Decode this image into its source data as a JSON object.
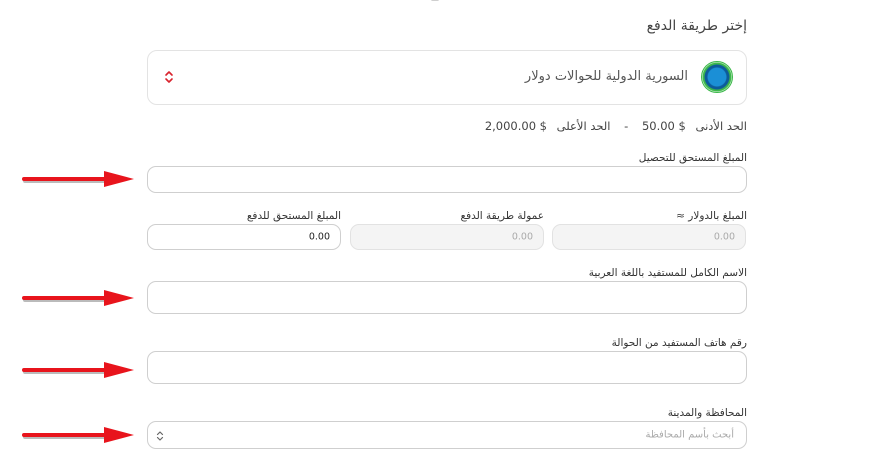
{
  "section_title": "إختر طريقة الدفع",
  "payment_method": {
    "name": "السورية الدولية للحوالات دولار",
    "logo_icon": "globe-transfer-icon"
  },
  "limits": {
    "min_label": "الحد الأدنى",
    "min_value": "50.00 $",
    "separator": "-",
    "max_label": "الحد الأعلى",
    "max_value": "2,000.00 $"
  },
  "amount_due_collection": {
    "label": "المبلغ المستحق للتحصيل",
    "value": ""
  },
  "amount_usd": {
    "label": "المبلغ بالدولار ≈",
    "value": "0.00"
  },
  "method_fee": {
    "label": "عمولة طريقة الدفع",
    "value": "0.00"
  },
  "amount_due_payment": {
    "label": "المبلغ المستحق للدفع",
    "value": "0.00"
  },
  "beneficiary_name": {
    "label": "الاسم الكامل للمستفيد باللغة العربية",
    "value": ""
  },
  "beneficiary_phone": {
    "label": "رقم هاتف المستفيد من الحوالة",
    "value": ""
  },
  "governorate_city": {
    "label": "المحافظة والمدينة",
    "placeholder": "أبحث بأسم المحافظة"
  },
  "colors": {
    "arrow": "#e8141c",
    "border": "#cfcfcf",
    "disabled_bg": "#f4f4f4"
  }
}
